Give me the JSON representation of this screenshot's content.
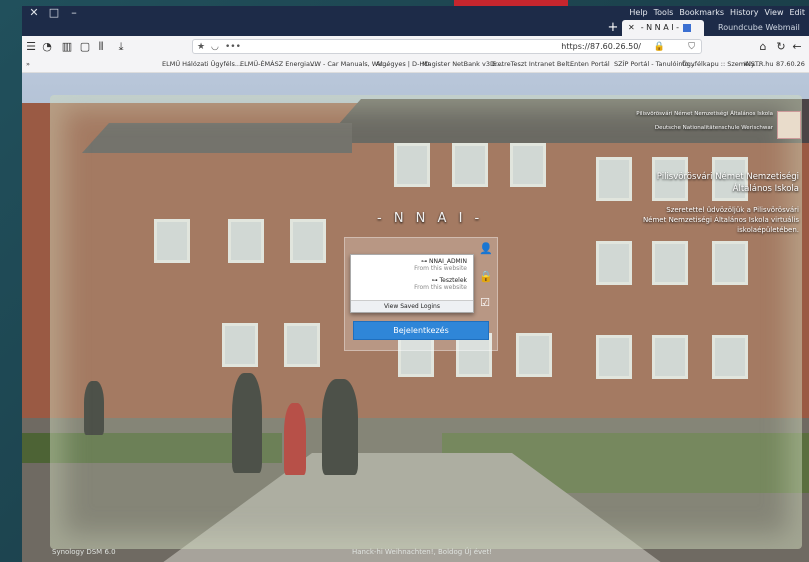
{
  "browser": {
    "menu": [
      "Help",
      "Tools",
      "Bookmarks",
      "History",
      "View",
      "Edit"
    ],
    "tabs": [
      {
        "label": "Roundcube Webmail :: Érkező",
        "active": false
      },
      {
        "label": "- N N A I -",
        "active": true
      }
    ],
    "url": "https://87.60.26.50/",
    "url_prefix": "•••",
    "bookmarks": [
      "87.60.26",
      "INSTR.hu",
      "Ügyfélkapu :: Személy...",
      "SZÍP Portál - Tanulóinfo...",
      "Enten Portál",
      "DretreTeszt Intranet Belt...",
      "Magister NetBank v3 E...",
      "Algégyes | D-HD",
      "VW - Car Manuals, Wir...",
      "ELMÜ-ÉMÁSZ Energia...",
      "ELMŰ Hálózati Ügyféls..."
    ]
  },
  "page": {
    "brand": "- N N A I -",
    "school_header_line1": "Pilisvörösvári Német Nemzetiségi Általános Iskola",
    "school_header_line2": "Deutsche Nationalitätenschule Werischwar",
    "school_name_line1": "Pilisvörösvári Német Nemzetiségi",
    "school_name_line2": "Általános Iskola",
    "welcome_line1": "Szeretettel üdvözöljük a Pilisvörösvári",
    "welcome_line2": "Német Nemzetiségi Általános Iskola virtuális",
    "welcome_line3": "iskolaépületében.",
    "login_button": "Bejelentkezés",
    "footer_left": "Synology DSM 6.0",
    "footer_center": "Hanck-hi Weihnachten!, Boldog Új évet!"
  },
  "autofill": {
    "items": [
      {
        "user": "NNAI_ADMIN",
        "note": "From this website"
      },
      {
        "user": "Tesztelek",
        "note": "From this website"
      }
    ],
    "footer": "View Saved Logins"
  },
  "icons": {
    "user": "user-icon",
    "lock": "lock-icon",
    "check": "checkbox-icon"
  }
}
